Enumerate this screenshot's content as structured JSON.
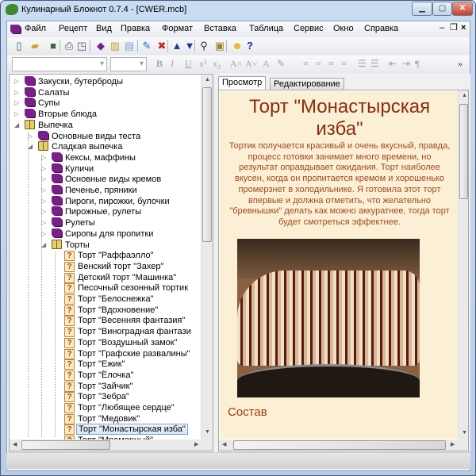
{
  "window": {
    "title": "Кулинарный Блокнот 0.7.4 - [CWER.mcb]"
  },
  "menu": [
    "Файл",
    "Рецепт",
    "Вид",
    "Правка",
    "Формат",
    "Вставка",
    "Таблица",
    "Сервис",
    "Окно",
    "Справка"
  ],
  "toolbar": {
    "icons": [
      "new-icon",
      "open-icon",
      "save-icon",
      "print-icon",
      "print-preview-icon",
      "category-icon",
      "open-category-icon",
      "recipe-icon",
      "edit-icon",
      "delete-icon",
      "move-up-icon",
      "move-down-icon",
      "find-icon",
      "image-icon",
      "smile-icon",
      "help-icon"
    ]
  },
  "format_toolbar": {
    "font_value": "",
    "size_value": "",
    "buttons": [
      "B",
      "I",
      "U",
      "x²",
      "x₂",
      "A˄",
      "A˅",
      "A",
      "✎",
      "≡",
      "≡",
      "≡",
      "≡",
      "☰",
      "☰",
      "⇤",
      "⇥",
      "¶"
    ],
    "more": "»"
  },
  "tree": [
    {
      "label": "Закуски, бутерброды",
      "level": 0,
      "type": "book",
      "state": "collapsed"
    },
    {
      "label": "Салаты",
      "level": 0,
      "type": "book",
      "state": "collapsed"
    },
    {
      "label": "Супы",
      "level": 0,
      "type": "book",
      "state": "collapsed"
    },
    {
      "label": "Вторые блюда",
      "level": 0,
      "type": "book",
      "state": "collapsed"
    },
    {
      "label": "Выпечка",
      "level": 0,
      "type": "open",
      "state": "expanded"
    },
    {
      "label": "Основные виды теста",
      "level": 1,
      "type": "book",
      "state": "collapsed"
    },
    {
      "label": "Сладкая выпечка",
      "level": 1,
      "type": "open",
      "state": "expanded"
    },
    {
      "label": "Кексы, маффины",
      "level": 2,
      "type": "book",
      "state": "collapsed"
    },
    {
      "label": "Куличи",
      "level": 2,
      "type": "book",
      "state": "collapsed"
    },
    {
      "label": "Основные виды кремов",
      "level": 2,
      "type": "book",
      "state": "collapsed"
    },
    {
      "label": "Печенье, пряники",
      "level": 2,
      "type": "book",
      "state": "collapsed"
    },
    {
      "label": "Пироги, пирожки, булочки",
      "level": 2,
      "type": "book",
      "state": "collapsed"
    },
    {
      "label": "Пирожные, рулеты",
      "level": 2,
      "type": "book",
      "state": "collapsed"
    },
    {
      "label": "Рулеты",
      "level": 2,
      "type": "book",
      "state": "collapsed"
    },
    {
      "label": "Сиропы для пропитки",
      "level": 2,
      "type": "book",
      "state": "collapsed"
    },
    {
      "label": "Торты",
      "level": 2,
      "type": "open",
      "state": "expanded"
    },
    {
      "label": "Торт \"Раффаэлло\"",
      "level": 3,
      "type": "recipe"
    },
    {
      "label": "Венский торт \"Захер\"",
      "level": 3,
      "type": "recipe"
    },
    {
      "label": "Детский торт \"Машинка\"",
      "level": 3,
      "type": "recipe"
    },
    {
      "label": "Песочный сезонный тортик",
      "level": 3,
      "type": "recipe"
    },
    {
      "label": "Торт \"Белоснежка\"",
      "level": 3,
      "type": "recipe"
    },
    {
      "label": "Торт \"Вдохновение\"",
      "level": 3,
      "type": "recipe"
    },
    {
      "label": "Торт \"Весенняя фантазия\"",
      "level": 3,
      "type": "recipe"
    },
    {
      "label": "Торт \"Виноградная фантази",
      "level": 3,
      "type": "recipe"
    },
    {
      "label": "Торт \"Воздушный замок\"",
      "level": 3,
      "type": "recipe"
    },
    {
      "label": "Торт \"Графские развалины\"",
      "level": 3,
      "type": "recipe"
    },
    {
      "label": "Торт \"Ежик\"",
      "level": 3,
      "type": "recipe"
    },
    {
      "label": "Торт \"Ёлочка\"",
      "level": 3,
      "type": "recipe"
    },
    {
      "label": "Торт \"Зайчик\"",
      "level": 3,
      "type": "recipe"
    },
    {
      "label": "Торт \"Зебра\"",
      "level": 3,
      "type": "recipe"
    },
    {
      "label": "Торт \"Любящее сердце\"",
      "level": 3,
      "type": "recipe"
    },
    {
      "label": "Торт \"Медовик\"",
      "level": 3,
      "type": "recipe"
    },
    {
      "label": "Торт \"Монастырская изба\"",
      "level": 3,
      "type": "recipe",
      "selected": true
    },
    {
      "label": "Торт \"Мраморный\"",
      "level": 3,
      "type": "recipe"
    }
  ],
  "tabs": [
    {
      "label": "Просмотр",
      "active": true
    },
    {
      "label": "Редактирование",
      "active": false
    }
  ],
  "recipe": {
    "title": "Торт \"Монастырская изба\"",
    "description": "Тортик получается  красивый и очень вкусный, правда, процесс готовки занимает много времени, но результат оправдывает ожидания. Торт наиболее вкусен, когда он пропитается кремом и хорошенько промерзнет в холодильнике. Я готовила этот торт впервые и должна отметить, что желательно \"бревнышки\" делать как можно аккуратнее, тогда торт будет смотреться эффектнее.",
    "section": "Состав"
  },
  "colors": {
    "background": "#fbf0d6",
    "title": "#8b2d0c",
    "text": "#a2481c"
  }
}
